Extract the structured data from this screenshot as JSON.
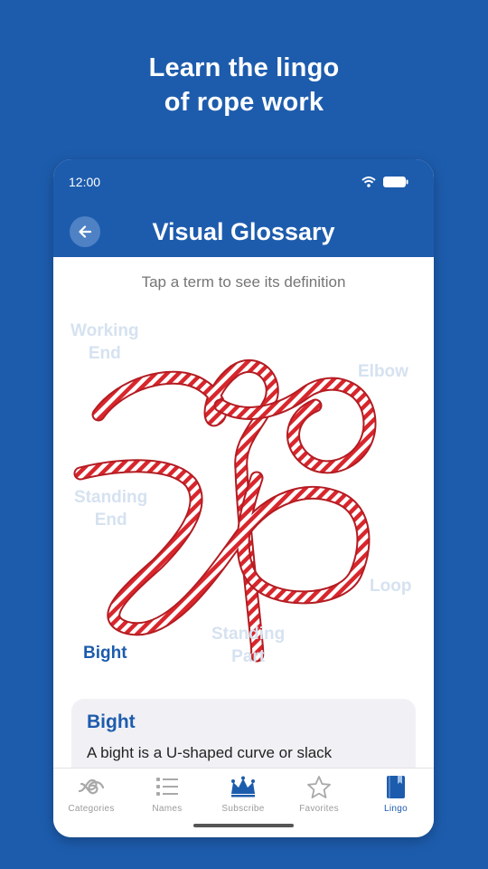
{
  "promo": {
    "title_line1": "Learn the lingo",
    "title_line2": "of rope work"
  },
  "status_bar": {
    "time": "12:00",
    "icons": [
      "wifi-icon",
      "battery-icon"
    ]
  },
  "app_bar": {
    "back_icon": "arrow-left-icon",
    "title": "Visual Glossary"
  },
  "instruction": "Tap a term to see its definition",
  "rope_diagram": {
    "image": "red-and-white rope arranged in loops",
    "terms": [
      {
        "line1": "Working",
        "line2": "End",
        "active": false
      },
      {
        "line1": "Elbow",
        "line2": "",
        "active": false
      },
      {
        "line1": "Standing",
        "line2": "End",
        "active": false
      },
      {
        "line1": "Loop",
        "line2": "",
        "active": false
      },
      {
        "line1": "Standing",
        "line2": "Part",
        "active": false
      },
      {
        "line1": "Bight",
        "line2": "",
        "active": true
      }
    ]
  },
  "definition": {
    "title": "Bight",
    "text": "A bight is a U-shaped curve or slack"
  },
  "bottom_nav": {
    "items": [
      {
        "label": "Categories",
        "icon": "knot-icon",
        "active": false
      },
      {
        "label": "Names",
        "icon": "list-icon",
        "active": false
      },
      {
        "label": "Subscribe",
        "icon": "crown-icon",
        "active": false
      },
      {
        "label": "Favorites",
        "icon": "star-icon",
        "active": false
      },
      {
        "label": "Lingo",
        "icon": "book-icon",
        "active": true
      }
    ]
  },
  "colors": {
    "brand": "#1d5cad",
    "term_inactive": "#d6e2f0",
    "card_bg": "#f1f1f5",
    "nav_inactive": "#9b9b9b"
  }
}
